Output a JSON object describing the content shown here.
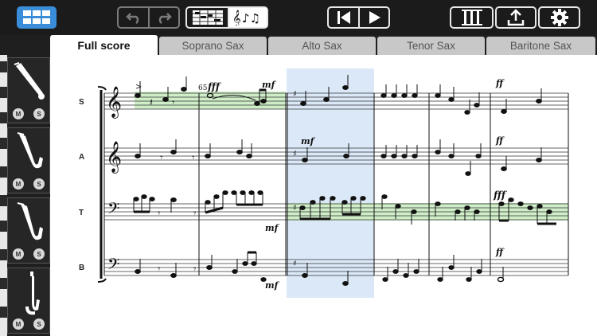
{
  "tabs": [
    {
      "label": "Full score",
      "active": true
    },
    {
      "label": "Soprano Sax",
      "active": false
    },
    {
      "label": "Alto Sax",
      "active": false
    },
    {
      "label": "Tenor Sax",
      "active": false
    },
    {
      "label": "Baritone Sax",
      "active": false
    }
  ],
  "parts": [
    {
      "label": "S",
      "instrument": "soprano-sax-icon"
    },
    {
      "label": "A",
      "instrument": "alto-sax-icon"
    },
    {
      "label": "T",
      "instrument": "tenor-sax-icon"
    },
    {
      "label": "B",
      "instrument": "baritone-sax-icon"
    }
  ],
  "mute_label": "M",
  "solo_label": "S",
  "markings": {
    "tempo_number": "65",
    "dyn_fff": "fff",
    "dyn_ff": "ff",
    "dyn_mf": "mf",
    "accent": ">"
  },
  "colors": {
    "accent": "#3a8dd8",
    "selection": "#dbe8f8",
    "highlight": "#cfeec8"
  },
  "icons": {
    "layout": "grid-layout-icon",
    "undo": "undo-icon",
    "redo": "redo-icon",
    "view_piano": "piano-roll-icon",
    "view_notes": "music-notes-icon",
    "rewind": "rewind-icon",
    "play": "play-icon",
    "mixer": "mixer-icon",
    "share": "share-icon",
    "settings": "gear-icon"
  }
}
